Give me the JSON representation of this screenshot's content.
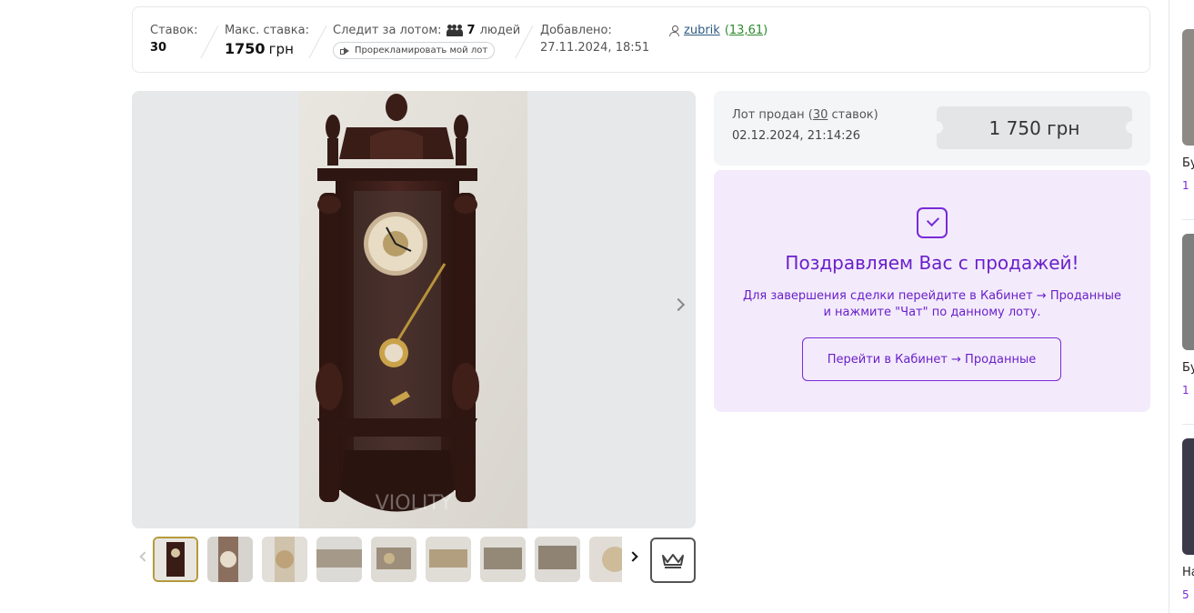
{
  "stats": {
    "bids_label": "Ставок:",
    "bids_value": "30",
    "max_bid_label": "Макс. ставка:",
    "max_bid_value": "1750",
    "max_bid_unit": "грн",
    "watchers_label": "Следит за лотом:",
    "watchers_count": "7",
    "watchers_unit": "людей",
    "promote_label": "Прорекламировать мой лот",
    "added_label": "Добавлено:",
    "added_value": "27.11.2024, 18:51",
    "seller_name": "zubrik",
    "seller_rating": "13,61"
  },
  "gallery": {
    "watermark": "VIOLITY",
    "thumb_count": 9
  },
  "sold": {
    "status_prefix": "Лот продан (",
    "bids_link": "30",
    "status_suffix": " ставок)",
    "date": "02.12.2024, 21:14:26",
    "price": "1 750 грн"
  },
  "congrats": {
    "title": "Поздравляем Вас с продажей!",
    "line1": "Для завершения сделки перейдите в Кабинет → Проданные",
    "line2": "и нажмите \"Чат\" по данному лоту.",
    "button": "Перейти в Кабинет → Проданные"
  },
  "sidebar": {
    "items": [
      {
        "text": "Бу",
        "num": "1"
      },
      {
        "text": "Бу",
        "num": "1"
      },
      {
        "text": "На",
        "num": "5"
      }
    ]
  },
  "colors": {
    "accent_purple": "#6a1fc9",
    "congrats_bg": "#f3ebfc",
    "active_thumb_border": "#b49a3c"
  }
}
